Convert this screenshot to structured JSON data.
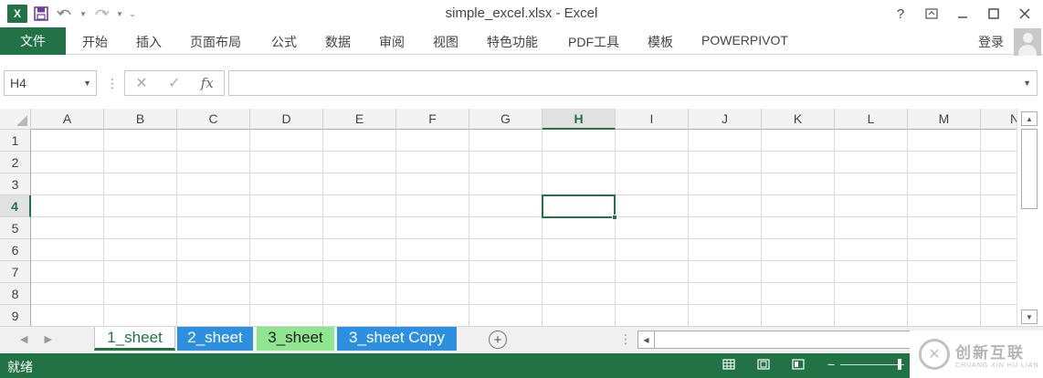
{
  "window": {
    "title": "simple_excel.xlsx - Excel",
    "help_label": "?",
    "controls": [
      "restore-ribbon",
      "minimize",
      "maximize",
      "close"
    ]
  },
  "quick_access": {
    "app_logo_letter": "X",
    "icons": [
      "save-icon",
      "undo-icon",
      "redo-icon",
      "customize-icon"
    ]
  },
  "ribbon": {
    "file_tab": "文件",
    "tabs": [
      "开始",
      "插入",
      "页面布局",
      "公式",
      "数据",
      "审阅",
      "视图",
      "特色功能",
      "PDF工具",
      "模板",
      "POWERPIVOT"
    ],
    "login_label": "登录"
  },
  "formula_bar": {
    "name_box": "H4",
    "fx_label": "fx",
    "formula": ""
  },
  "grid": {
    "columns": [
      "A",
      "B",
      "C",
      "D",
      "E",
      "F",
      "G",
      "H",
      "I",
      "J",
      "K",
      "L",
      "M",
      "N"
    ],
    "rows": [
      "1",
      "2",
      "3",
      "4",
      "5",
      "6",
      "7",
      "8",
      "9"
    ],
    "selected_column": "H",
    "selected_row": "4"
  },
  "sheets": {
    "tabs": [
      {
        "label": "1_sheet",
        "style": "active"
      },
      {
        "label": "2_sheet",
        "style": "blue",
        "color": "#2d8fe0"
      },
      {
        "label": "3_sheet",
        "style": "green",
        "color": "#8fe68f"
      },
      {
        "label": "3_sheet Copy",
        "style": "blue",
        "color": "#2d8fe0"
      }
    ],
    "add_label": "+"
  },
  "status_bar": {
    "ready_text": "就绪"
  },
  "watermark": {
    "name": "创新互联",
    "subtitle": "CHUANG XIN HU LIAN"
  },
  "colors": {
    "accent": "#217346"
  }
}
